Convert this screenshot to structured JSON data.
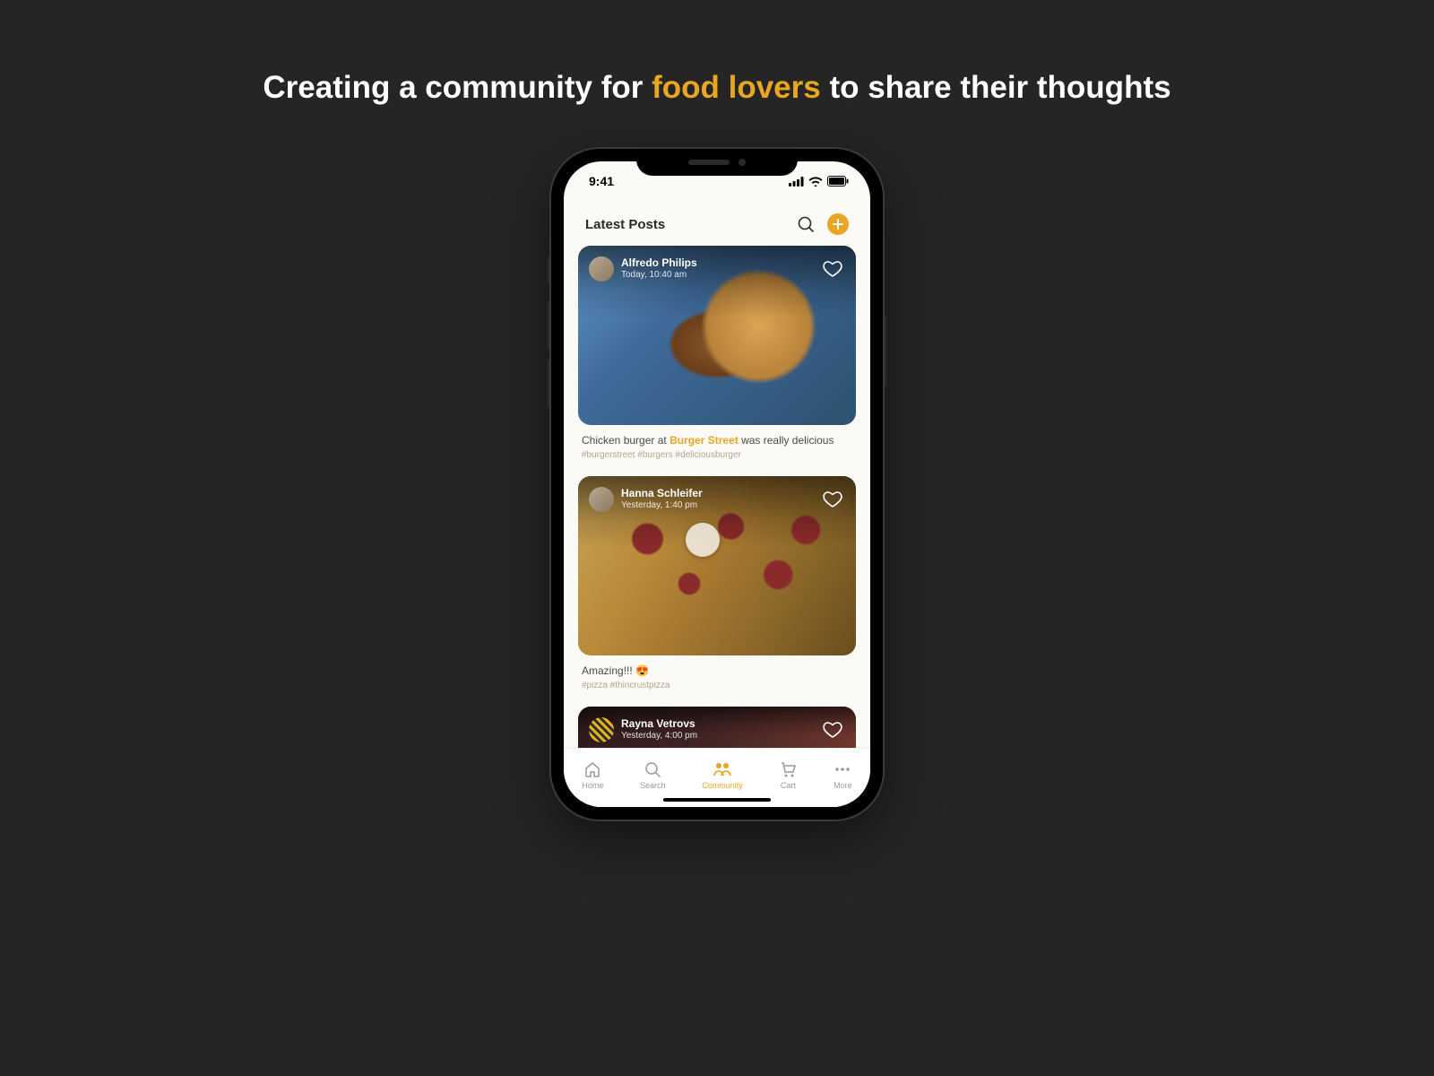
{
  "headline": {
    "pre": "Creating a community for ",
    "hilite": "food lovers",
    "post": " to share their thoughts"
  },
  "status": {
    "time": "9:41"
  },
  "header": {
    "title": "Latest Posts"
  },
  "posts": [
    {
      "author": "Alfredo Philips",
      "time": "Today, 10:40 am",
      "caption_pre": "Chicken burger at ",
      "caption_place": "Burger Street",
      "caption_post": " was really delicious",
      "hashtags": "#burgerstreet  #burgers  #deliciousburger"
    },
    {
      "author": "Hanna Schleifer",
      "time": "Yesterday, 1:40 pm",
      "caption": "Amazing!!! 😍",
      "hashtags": "#pizza  #thincrustpizza"
    },
    {
      "author": "Rayna Vetrovs",
      "time": "Yesterday, 4:00 pm"
    }
  ],
  "tabs": [
    {
      "label": "Home"
    },
    {
      "label": "Search"
    },
    {
      "label": "Community"
    },
    {
      "label": "Cart"
    },
    {
      "label": "More"
    }
  ]
}
